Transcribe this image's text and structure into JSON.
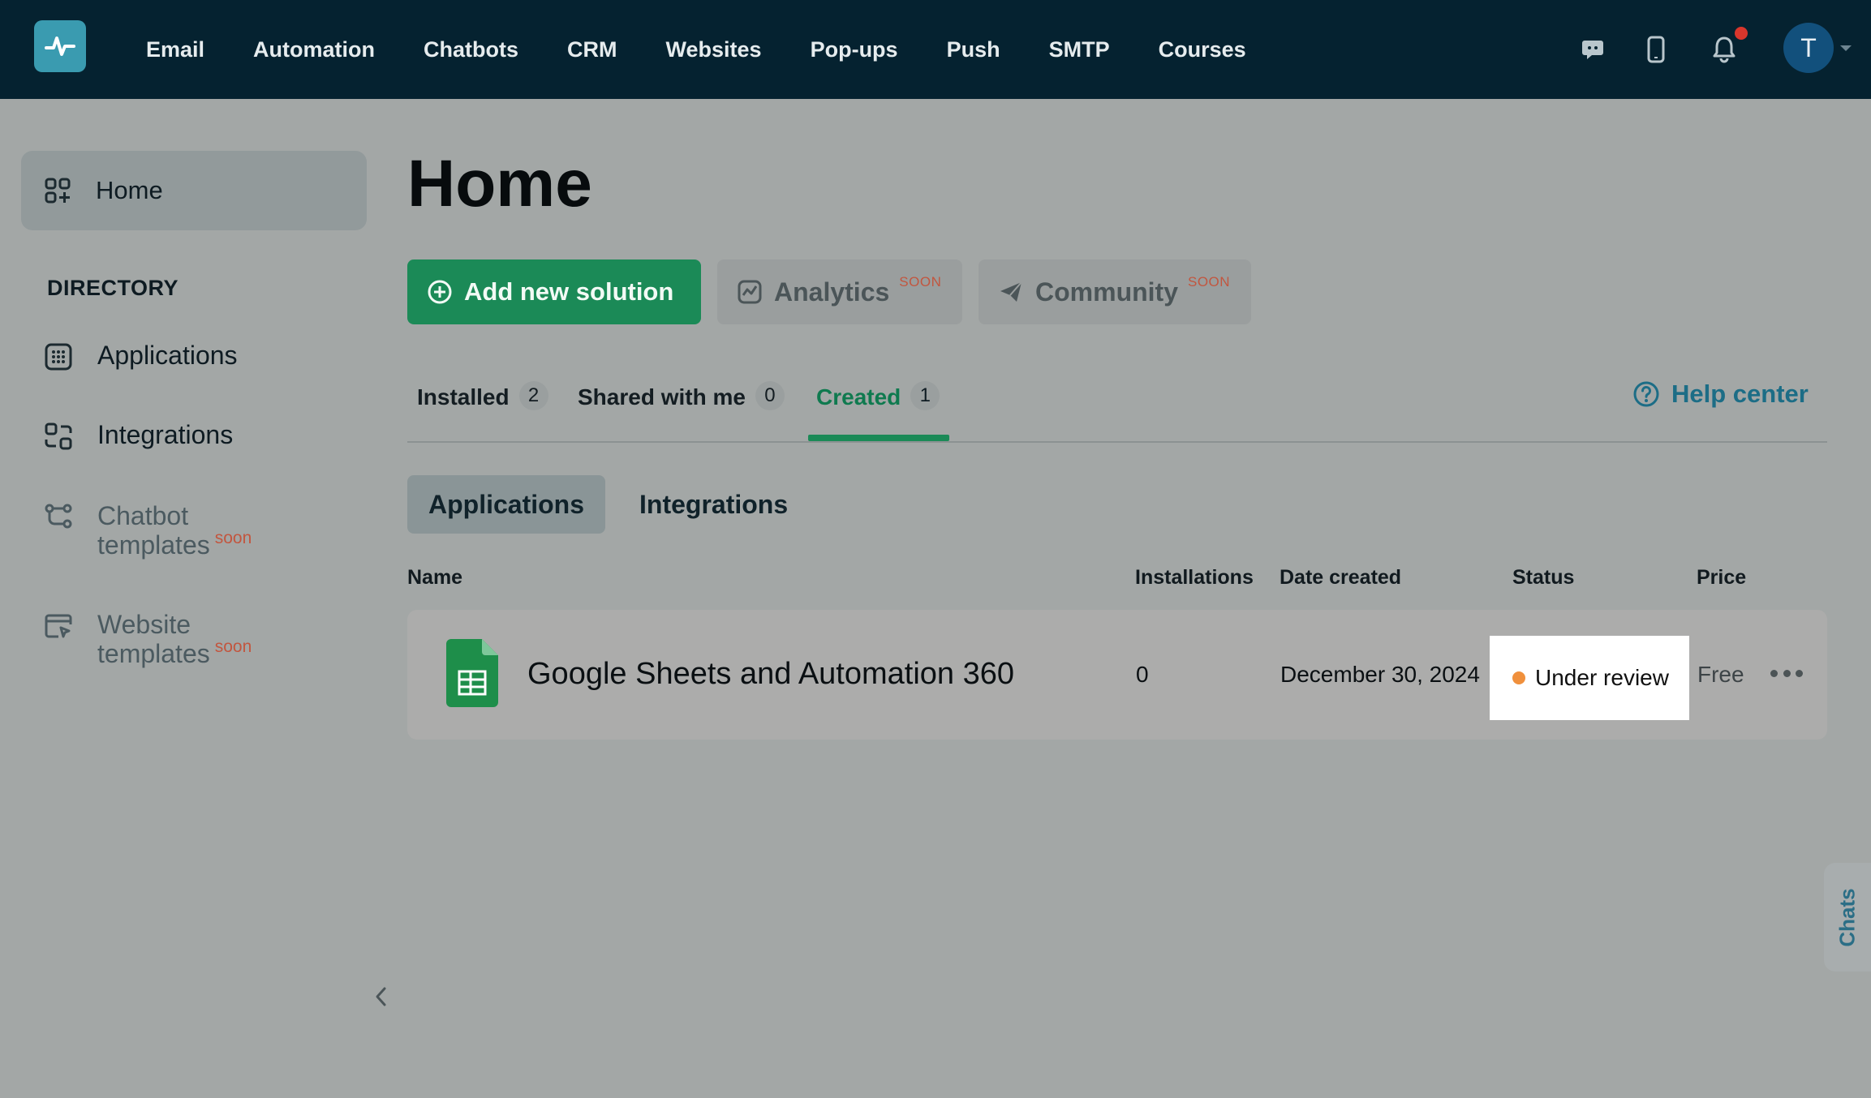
{
  "nav": {
    "items": [
      "Email",
      "Automation",
      "Chatbots",
      "CRM",
      "Websites",
      "Pop-ups",
      "Push",
      "SMTP",
      "Courses"
    ],
    "avatar_initial": "T"
  },
  "sidebar": {
    "home_label": "Home",
    "directory_title": "DIRECTORY",
    "applications_label": "Applications",
    "integrations_label": "Integrations",
    "chatbot_templates_line1": "Chatbot",
    "chatbot_templates_line2": "templates",
    "website_templates_line1": "Website",
    "website_templates_line2": "templates",
    "soon_label": "soon"
  },
  "main": {
    "title": "Home",
    "add_button": "Add new solution",
    "analytics_button": "Analytics",
    "community_button": "Community",
    "soon_badge": "SOON",
    "tabs": [
      {
        "label": "Installed",
        "count": "2"
      },
      {
        "label": "Shared with me",
        "count": "0"
      },
      {
        "label": "Created",
        "count": "1"
      }
    ],
    "help_center": "Help center",
    "subtabs": [
      "Applications",
      "Integrations"
    ],
    "columns": [
      "Name",
      "Installations",
      "Date created",
      "Status",
      "Price"
    ],
    "rows": [
      {
        "name": "Google Sheets and Automation 360",
        "installations": "0",
        "date_created": "December 30, 2024",
        "status": "Under review",
        "price": "Free"
      }
    ]
  },
  "chats_tab": "Chats",
  "colors": {
    "topbar": "#052230",
    "accent_green": "#1b8a57",
    "soon_red": "#c2563f",
    "link_blue": "#1c6d86",
    "status_dot": "#f0903c"
  }
}
